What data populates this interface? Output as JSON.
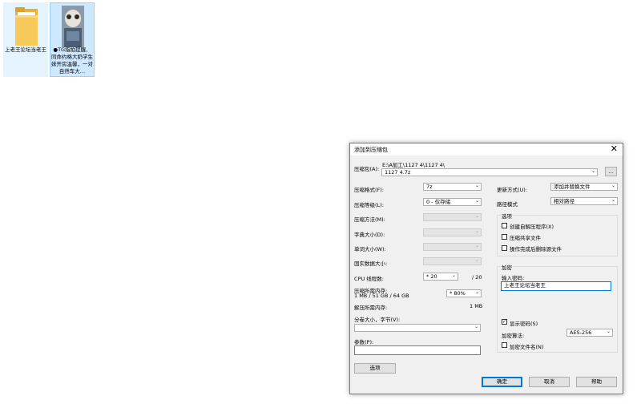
{
  "desktop": {
    "files": [
      {
        "name": "上老王论坛当老王",
        "kind": "folder"
      },
      {
        "name": "●TG指拍提醒、同命约格大奶学生妹开房温馨，一对自然车大…",
        "kind": "image"
      }
    ]
  },
  "dialog": {
    "title": "添加到压缩包",
    "archive_label": "压缩包(A):",
    "archive_path": "E:\\A加工\\1127 4\\1127 4\\",
    "archive_name": "1127 4.7z",
    "browse_label": "...",
    "left": {
      "format_label": "压缩格式(F):",
      "format_value": "7z",
      "level_label": "压缩等级(L):",
      "level_value": "0 - 仅存储",
      "method_label": "压缩方法(M):",
      "dict_label": "字典大小(D):",
      "word_label": "单词大小(W):",
      "solid_label": "固实数据大小:",
      "cpu_label": "CPU 线程数:",
      "cpu_value": "* 20",
      "cpu_total": "/ 20",
      "mem_label": "压缩所需内存:",
      "mem_detail": "1 MB / 51 GB / 64 GB",
      "mem_percent": "* 80%",
      "decomp_label": "解压所需内存:",
      "decomp_value": "1 MB",
      "split_label": "分卷大小，字节(V):",
      "params_label": "参数(P):",
      "options_button": "选项"
    },
    "right": {
      "update_label": "更新方式(U):",
      "update_value": "添加并替换文件",
      "path_label": "路径模式",
      "path_value": "相对路径",
      "options_group": "选项",
      "opt_sfx": "创建自解压程序(X)",
      "opt_shared": "压缩共享文件",
      "opt_delete": "操作完成后删除源文件",
      "encrypt_group": "加密",
      "password_label": "输入密码:",
      "password_value": "上老王论坛当老王",
      "show_password": "显示密码(S)",
      "show_password_check": "✓",
      "algo_label": "加密算法:",
      "algo_value": "AES-256",
      "encrypt_names": "加密文件名(N)"
    },
    "buttons": {
      "ok": "确定",
      "cancel": "取消",
      "help": "帮助"
    }
  }
}
